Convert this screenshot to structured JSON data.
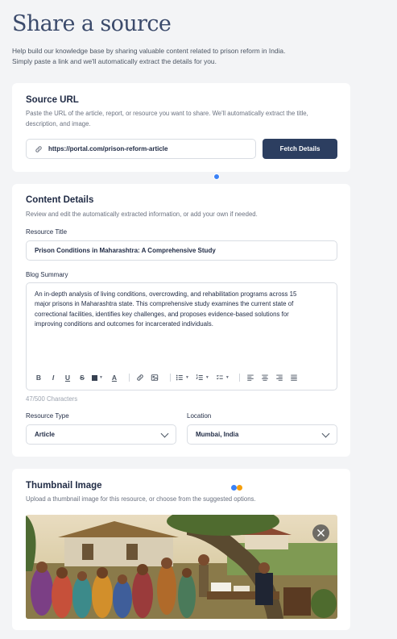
{
  "header": {
    "title": "Share a source",
    "subtitle": "Help build our knowledge base by sharing valuable content related to prison reform in India. Simply paste a link and we'll automatically extract the details for you."
  },
  "source_url": {
    "title": "Source URL",
    "description": "Paste the URL of the article, report, or resource you want to share. We'll automatically extract the title, description, and image.",
    "url_value": "https://portal.com/prison-reform-article",
    "fetch_label": "Fetch Details"
  },
  "content_details": {
    "title": "Content Details",
    "description": "Review and edit the automatically extracted information, or add your own if needed.",
    "resource_title_label": "Resource Title",
    "resource_title_value": "Prison Conditions in Maharashtra: A Comprehensive Study",
    "summary_label": "Blog Summary",
    "summary_value": "An in-depth analysis of living conditions, overcrowding, and rehabilitation programs across 15 major prisons in Maharashtra state. This comprehensive study examines the current state of correctional facilities, identifies key challenges, and proposes evidence-based solutions for improving conditions and outcomes for incarcerated individuals.",
    "char_count": "47/500 Characters",
    "resource_type_label": "Resource Type",
    "resource_type_value": "Article",
    "location_label": "Location",
    "location_value": "Mumbai, India",
    "toolbar": [
      "bold-icon",
      "italic-icon",
      "underline-icon",
      "strikethrough-icon",
      "text-color-icon",
      "highlight-icon",
      "link-icon",
      "image-icon",
      "bullet-list-icon",
      "numbered-list-icon",
      "checklist-icon",
      "align-left-icon",
      "align-center-icon",
      "align-right-icon",
      "align-justify-icon"
    ]
  },
  "thumbnail": {
    "title": "Thumbnail Image",
    "description": "Upload a thumbnail image for this resource, or choose from the suggested options.",
    "close_icon": "close-icon"
  },
  "colors": {
    "primary": "#2c3e60",
    "background": "#f3f4f6",
    "card": "#ffffff",
    "indicator_blue": "#3b82f6",
    "indicator_orange": "#f59e0b"
  }
}
